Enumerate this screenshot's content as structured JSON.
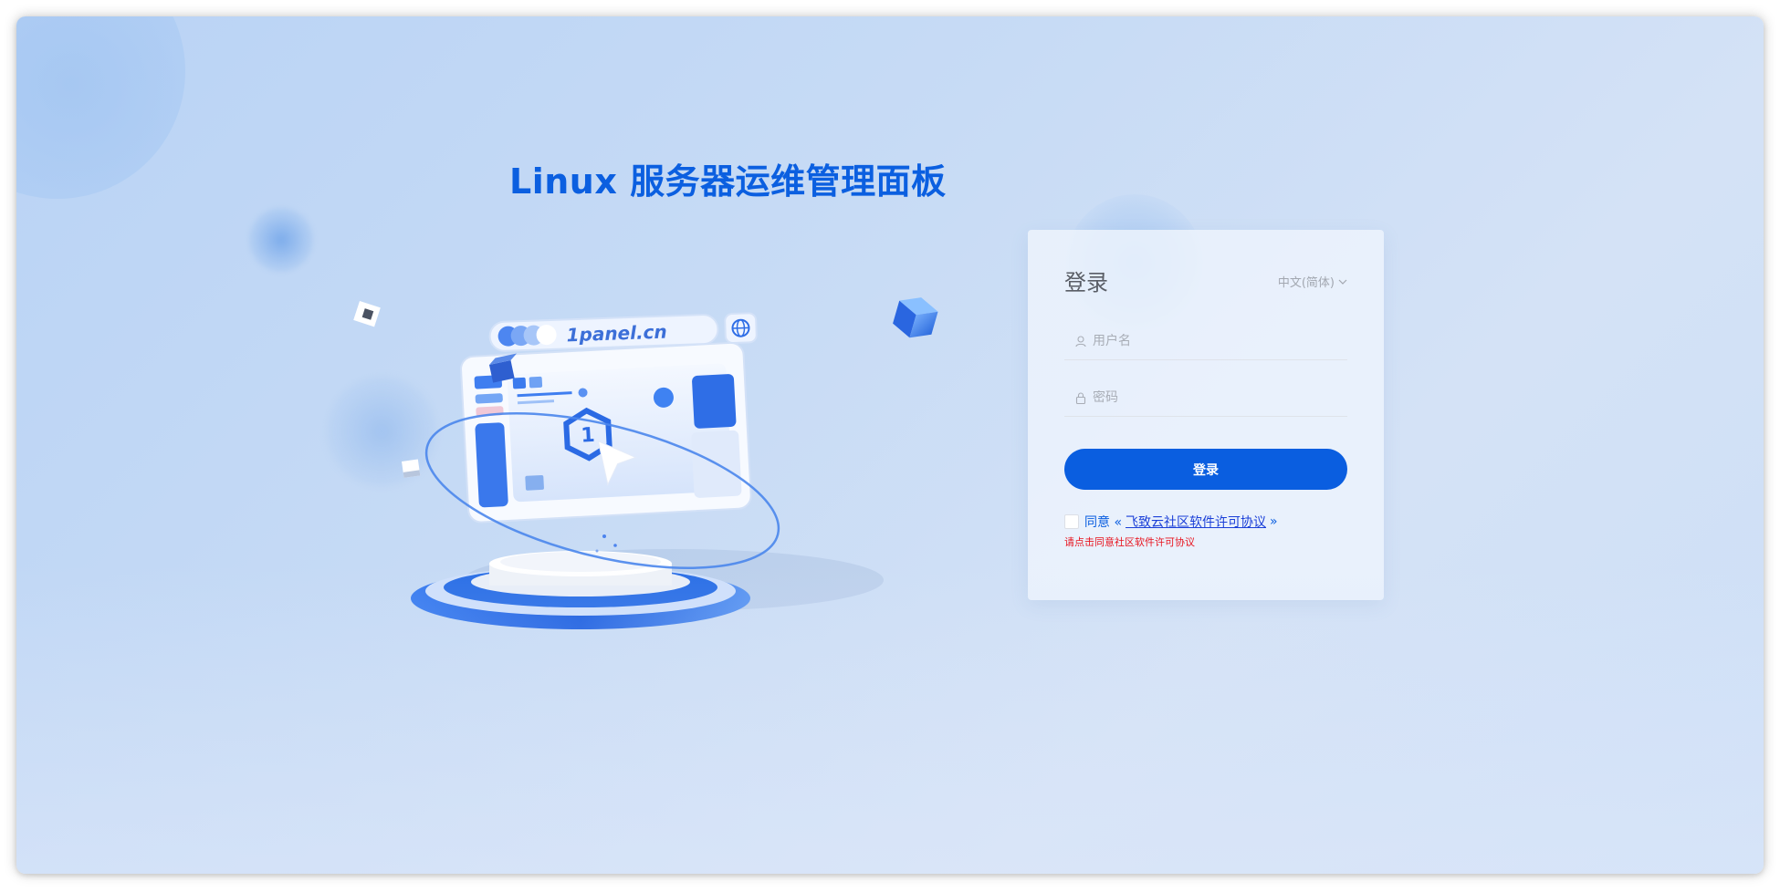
{
  "hero": {
    "title": "Linux 服务器运维管理面板",
    "illustration_url_label": "1panel.cn"
  },
  "login": {
    "title": "登录",
    "language": "中文(简体)",
    "username_placeholder": "用户名",
    "password_placeholder": "密码",
    "submit_label": "登录",
    "agree_prefix": "同意 «",
    "agreement_link": "飞致云社区软件许可协议",
    "agree_suffix": "»",
    "agree_checked": false,
    "error_message": "请点击同意社区软件许可协议"
  },
  "colors": {
    "primary": "#0a5ee0",
    "title_blue": "#0b5fe0",
    "error_red": "#e8141f",
    "link_blue": "#1a3fd8"
  },
  "icons": {
    "username": "user-icon",
    "password": "lock-icon",
    "language": "chevron-down-icon"
  }
}
